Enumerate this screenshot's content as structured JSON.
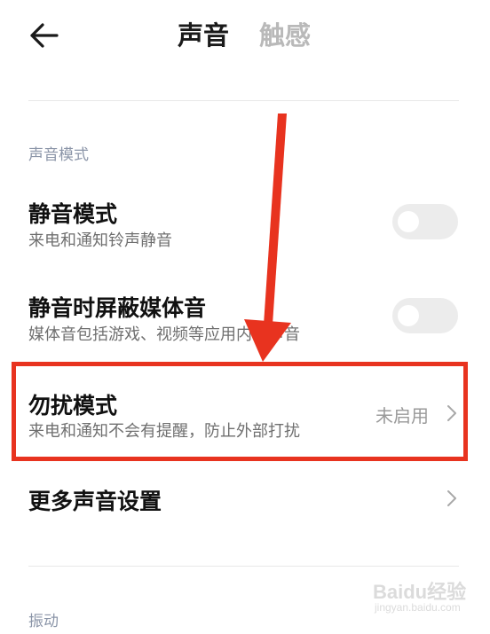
{
  "header": {
    "back_icon": "arrow-left-icon",
    "tabs": [
      {
        "label": "声音",
        "active": true
      },
      {
        "label": "触感",
        "active": false
      }
    ]
  },
  "sections": {
    "sound_mode": {
      "title": "声音模式",
      "rows": [
        {
          "title": "静音模式",
          "subtitle": "来电和通知铃声静音",
          "control": "toggle",
          "enabled": false
        },
        {
          "title": "静音时屏蔽媒体音",
          "subtitle": "媒体音包括游戏、视频等应用内的声音",
          "control": "toggle",
          "enabled": false
        },
        {
          "title": "勿扰模式",
          "subtitle": "来电和通知不会有提醒，防止外部打扰",
          "control": "chevron",
          "value": "未启用"
        },
        {
          "title": "更多声音设置",
          "control": "chevron"
        }
      ]
    },
    "vibration": {
      "title": "振动"
    }
  },
  "annotation": {
    "highlight_color": "#e8331f"
  },
  "watermark": {
    "brand": "Baidu经验",
    "url": "jingyan.baidu.com"
  },
  "colors": {
    "section_title": "#8b95a8",
    "toggle_off": "#ececec",
    "inactive_tab": "#b9b9b9"
  }
}
